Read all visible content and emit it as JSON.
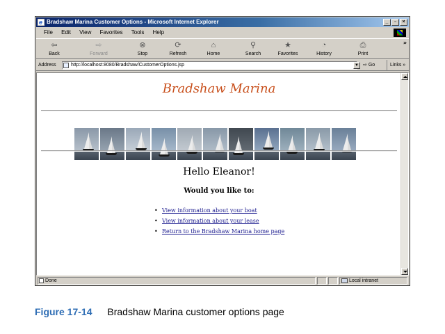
{
  "window": {
    "title": "Bradshaw Marina Customer Options - Microsoft Internet Explorer",
    "controls": [
      "_",
      "▫",
      "×"
    ]
  },
  "menu": [
    "File",
    "Edit",
    "View",
    "Favorites",
    "Tools",
    "Help"
  ],
  "toolbar": {
    "buttons": [
      {
        "label": "Back",
        "icon": "back-arrow-icon",
        "glyph": "⇦",
        "enabled": true
      },
      {
        "label": "Forward",
        "icon": "forward-arrow-icon",
        "glyph": "⇨",
        "enabled": false
      },
      {
        "label": "Stop",
        "icon": "stop-icon",
        "glyph": "⊗",
        "enabled": true
      },
      {
        "label": "Refresh",
        "icon": "refresh-icon",
        "glyph": "⟳",
        "enabled": true
      },
      {
        "label": "Home",
        "icon": "home-icon",
        "glyph": "⌂",
        "enabled": true
      },
      {
        "label": "Search",
        "icon": "search-icon",
        "glyph": "⚲",
        "enabled": true
      },
      {
        "label": "Favorites",
        "icon": "favorites-icon",
        "glyph": "★",
        "enabled": true
      },
      {
        "label": "History",
        "icon": "history-icon",
        "glyph": "◔",
        "enabled": true
      },
      {
        "label": "Print",
        "icon": "print-icon",
        "glyph": "⎙",
        "enabled": true
      }
    ],
    "more": "»"
  },
  "address": {
    "label": "Address",
    "url": "http://localhost:8080/Bradshaw/CustomerOptions.jsp",
    "go": "Go",
    "links": "Links »"
  },
  "page": {
    "site_title": "Bradshaw Marina",
    "greeting": "Hello Eleanor!",
    "question": "Would you like to:",
    "options": [
      "View information about your boat",
      "View information about your lease",
      "Return to the Bradshaw Marina home page"
    ],
    "photo_count": 11
  },
  "status": {
    "text": "Done",
    "zone": "Local intranet"
  },
  "caption": {
    "label": "Figure 17-14",
    "text": "Bradshaw Marina customer options page"
  },
  "colors": {
    "title_accent": "#c84e1a",
    "link": "#1a1a8e",
    "caption_label": "#2e6db4",
    "titlebar_start": "#0a246a"
  }
}
